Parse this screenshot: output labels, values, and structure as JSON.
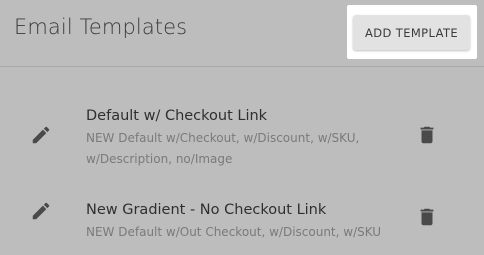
{
  "header": {
    "title": "Email Templates",
    "add_button_label": "ADD TEMPLATE"
  },
  "templates": [
    {
      "title": "Default w/ Checkout Link",
      "description": "NEW Default w/Checkout, w/Discount, w/SKU, w/Description, no/Image",
      "edit_icon": "pencil-icon",
      "delete_icon": "trash-icon"
    },
    {
      "title": "New Gradient - No Checkout Link",
      "description": "NEW Default w/Out Checkout, w/Discount, w/SKU",
      "edit_icon": "pencil-icon",
      "delete_icon": "trash-icon"
    }
  ],
  "colors": {
    "background": "#bdbdbd",
    "icon": "#4a4a4a",
    "highlight": "#ffffff"
  }
}
